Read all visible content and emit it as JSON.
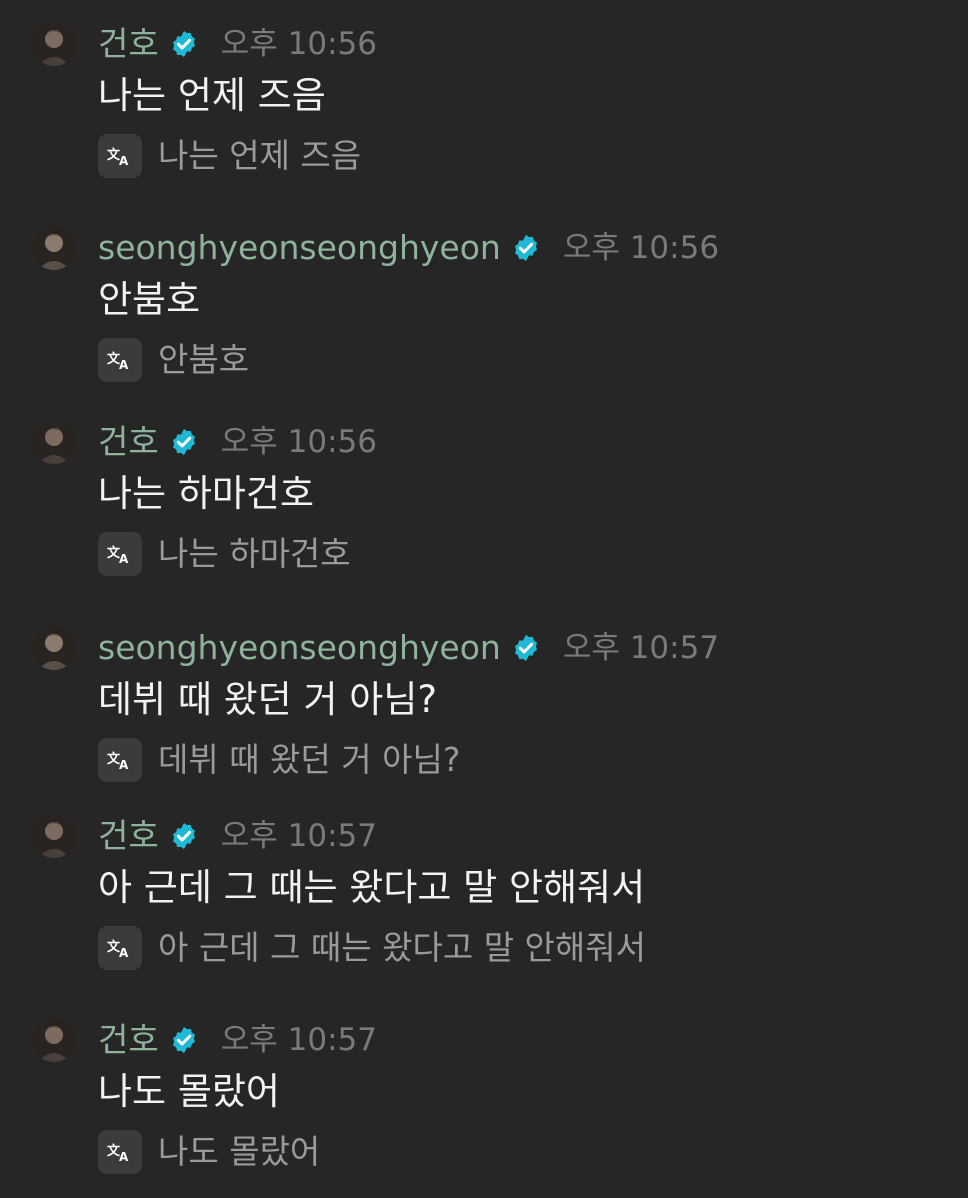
{
  "messages": [
    {
      "name": "건호",
      "time": "오후 10:56",
      "text": "나는 언제 즈음",
      "translation": "나는 언제 즈음"
    },
    {
      "name": "seonghyeonseonghyeon",
      "time": "오후 10:56",
      "text": "안붐호",
      "translation": "안붐호"
    },
    {
      "name": "건호",
      "time": "오후 10:56",
      "text": "나는 하마건호",
      "translation": "나는 하마건호"
    },
    {
      "name": "seonghyeonseonghyeon",
      "time": "오후 10:57",
      "text": "데뷔 때 왔던 거 아님?",
      "translation": "데뷔 때 왔던 거 아님?"
    },
    {
      "name": "건호",
      "time": "오후 10:57",
      "text": "아 근데 그 때는 왔다고 말 안해줘서",
      "translation": "아 근데 그 때는 왔다고 말 안해줘서"
    },
    {
      "name": "건호",
      "time": "오후 10:57",
      "text": "나도 몰랐어",
      "translation": "나도 몰랐어"
    }
  ],
  "icons": {
    "verified": "verified-badge-icon",
    "translate": "translate-icon",
    "avatar": "user-avatar"
  },
  "colors": {
    "background": "#262626",
    "name": "#8fb39a",
    "verified": "#1fb9d6",
    "time": "#7a7a7a",
    "text": "#f2f2f2",
    "translated": "#9a9a9a"
  }
}
